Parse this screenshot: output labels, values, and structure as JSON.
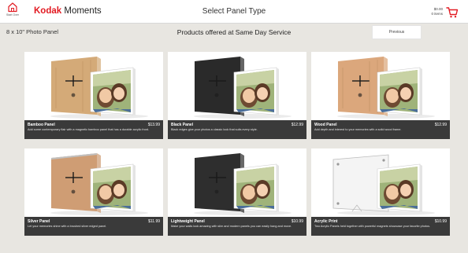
{
  "header": {
    "home_label": "Start Over",
    "brand_name": "Kodak",
    "brand_suffix": "Moments",
    "title": "Select Panel Type",
    "cart_amount": "$0.00",
    "cart_items": "0 items"
  },
  "subheader": {
    "panel_size": "8 x 10\" Photo Panel",
    "title": "Products offered at Same Day Service",
    "previous_label": "Previous"
  },
  "colors": {
    "brand_red": "#e21a22",
    "bar_bg": "#3a3a3a",
    "page_bg": "#e8e6e1"
  },
  "products": [
    {
      "name": "Bamboo Panel",
      "price": "$13.99",
      "description": "Add some contemporary flair with a magnetic bamboo panel that has a durable acrylic front.",
      "back_color": "#d4aa78",
      "back_style": "wood"
    },
    {
      "name": "Black Panel",
      "price": "$12.99",
      "description": "Black edges give your photos a classic look that suits every style.",
      "back_color": "#2a2a2a",
      "back_style": "black"
    },
    {
      "name": "Wood Panel",
      "price": "$12.99",
      "description": "Add depth and interest to your memories with a solid wood frame.",
      "back_color": "#dba77c",
      "back_style": "wood"
    },
    {
      "name": "Silver Panel",
      "price": "$11.99",
      "description": "Let your memories shine with a brushed silver edged panel.",
      "back_color": "#cf9d74",
      "back_style": "silver"
    },
    {
      "name": "Lightweight Panel",
      "price": "$10.99",
      "description": "Make your walls look amazing with slim and modern panels you can easily hang and move.",
      "back_color": "#2e2e2e",
      "back_style": "black"
    },
    {
      "name": "Acrylic Print",
      "price": "$10.99",
      "description": "Two Acrylic Panels held together with powerful magnets showcase your favorite photos.",
      "back_color": "#eeeeee",
      "back_style": "acrylic"
    }
  ]
}
